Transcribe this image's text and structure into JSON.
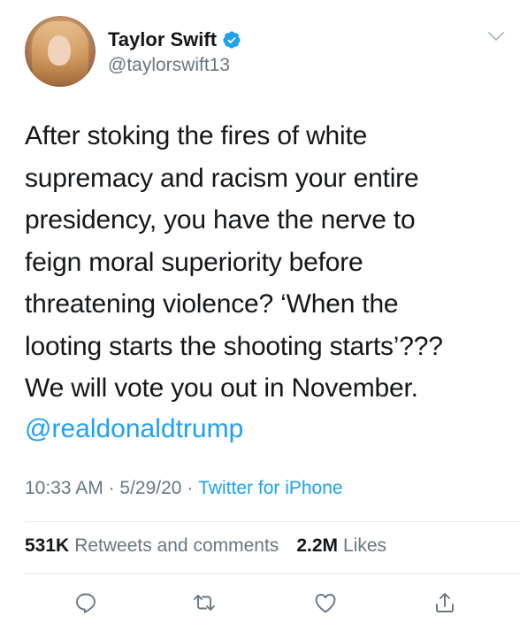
{
  "author": {
    "display_name": "Taylor Swift",
    "handle": "@taylorswift13",
    "verified": true
  },
  "tweet": {
    "text": "After stoking the fires of white\nsupremacy and racism your entire\npresidency, you have the nerve to\nfeign moral superiority before\nthreatening violence? ‘When the\nlooting starts the shooting starts’???\nWe will vote you out in November.",
    "mention": "@realdonaldtrump",
    "time": "10:33 AM",
    "date": "5/29/20",
    "separator": "·",
    "source": "Twitter for iPhone"
  },
  "stats": {
    "retweets_count": "531K",
    "retweets_label": "Retweets and comments",
    "likes_count": "2.2M",
    "likes_label": "Likes"
  },
  "colors": {
    "link": "#1da1f2",
    "secondary": "#657786",
    "primary_text": "#14171a",
    "divider": "#e1e8ed"
  },
  "icons": {
    "reply": "reply-icon",
    "retweet": "retweet-icon",
    "like": "like-icon",
    "share": "share-icon",
    "verified": "verified-badge-icon",
    "more": "chevron-down-icon"
  }
}
